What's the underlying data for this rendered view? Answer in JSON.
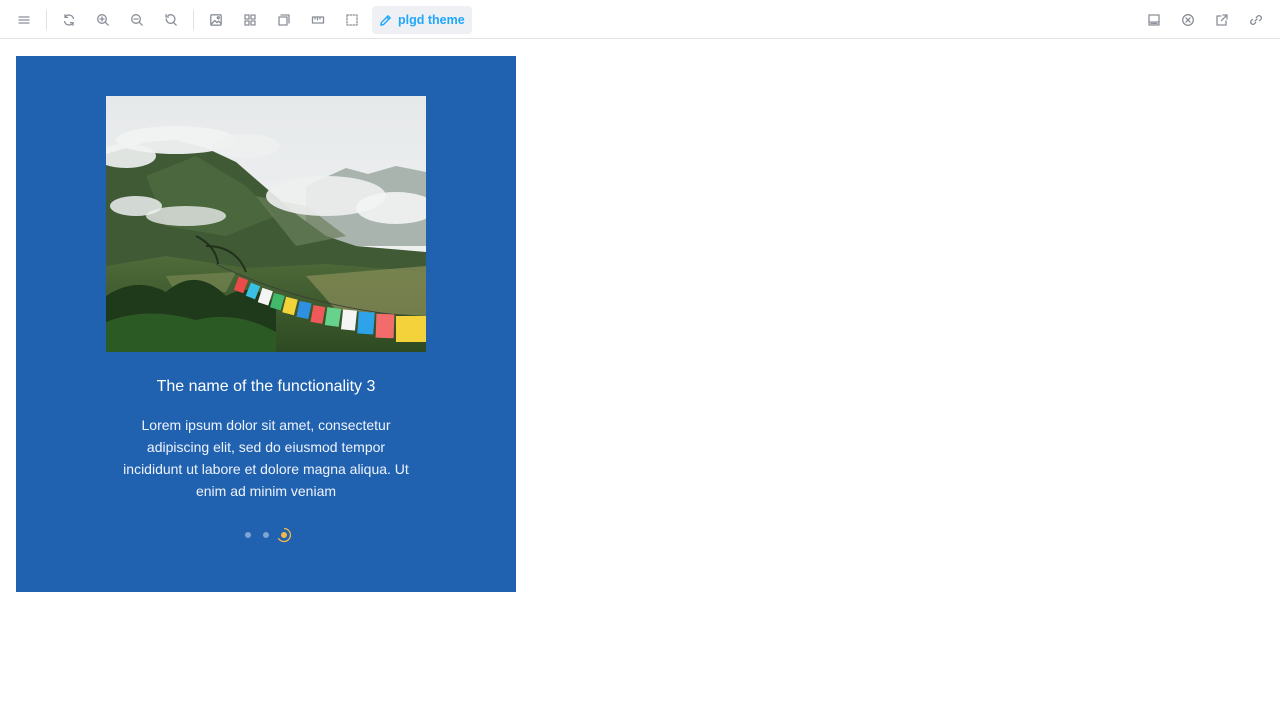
{
  "toolbar": {
    "left_icons": [
      "menu-icon",
      "reload-icon",
      "zoom-in-icon",
      "zoom-out-icon",
      "zoom-reset-icon",
      "background-icon",
      "grid-icon",
      "outline-icon",
      "measure-icon",
      "viewport-icon"
    ],
    "theme_label": "plgd theme",
    "right_icons": [
      "panel-icon",
      "close-icon",
      "open-new-tab-icon",
      "copy-link-icon"
    ]
  },
  "slide": {
    "title": "The name of the functionality 3",
    "description": "Lorem ipsum dolor sit amet, consectetur adipiscing elit, sed do eiusmod tempor incididunt ut labore et dolore magna aliqua. Ut enim ad minim veniam",
    "image_alt": "Mountains with prayer flags",
    "current_index": 3,
    "total": 3
  },
  "colors": {
    "background": "#2162b0",
    "accent": "#1ea7fd",
    "dot_active": "#f5b94a",
    "dot_inactive": "#7ea3d4"
  }
}
